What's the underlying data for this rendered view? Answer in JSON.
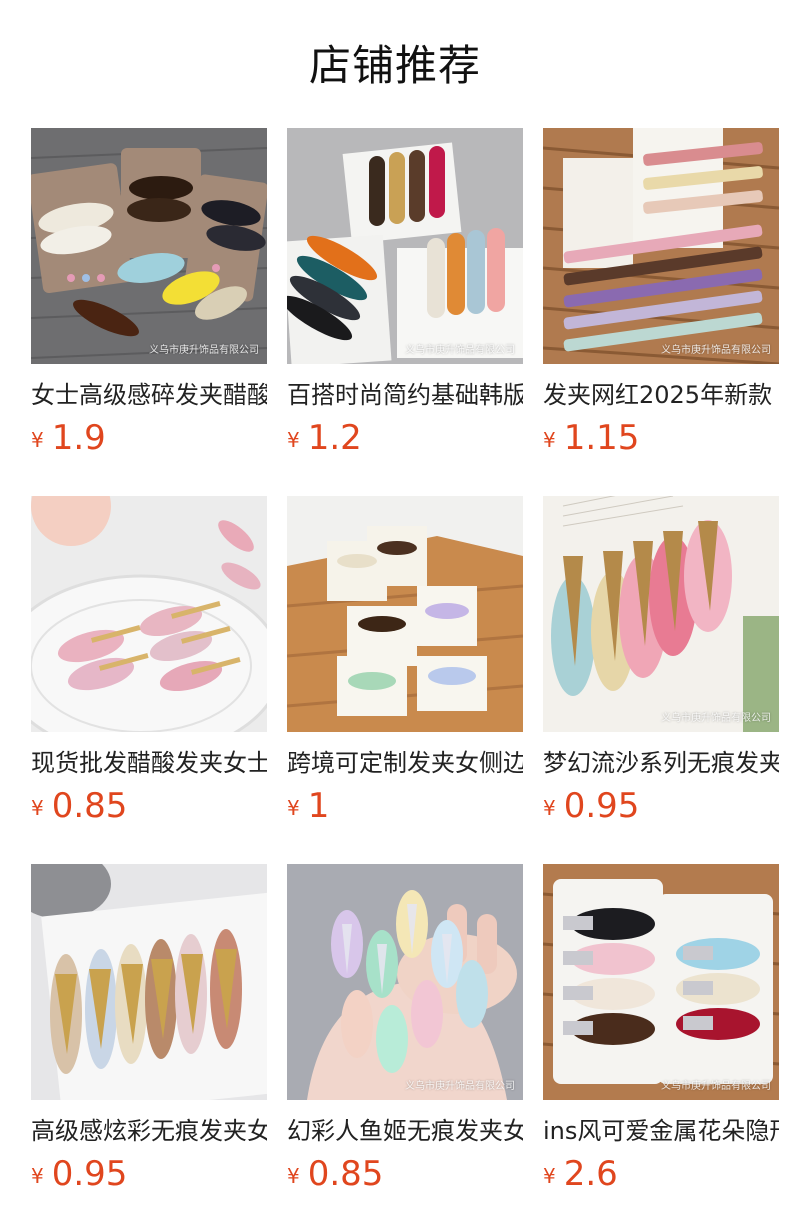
{
  "title": "店铺推荐",
  "currency_symbol": "¥",
  "watermark": "义乌市庚升饰品有限公司",
  "products": [
    {
      "name": "女士高级感碎发夹醋酸",
      "price": "1.9"
    },
    {
      "name": "百搭时尚简约基础韩版",
      "price": "1.2"
    },
    {
      "name": "发夹网红2025年新款",
      "price": "1.15"
    },
    {
      "name": "现货批发醋酸发夹女士",
      "price": "0.85"
    },
    {
      "name": "跨境可定制发夹女侧边",
      "price": "1"
    },
    {
      "name": "梦幻流沙系列无痕发夹",
      "price": "0.95"
    },
    {
      "name": "高级感炫彩无痕发夹女",
      "price": "0.95"
    },
    {
      "name": "幻彩人鱼姬无痕发夹女",
      "price": "0.85"
    },
    {
      "name": "ins风可爱金属花朵隐形",
      "price": "2.6"
    }
  ]
}
